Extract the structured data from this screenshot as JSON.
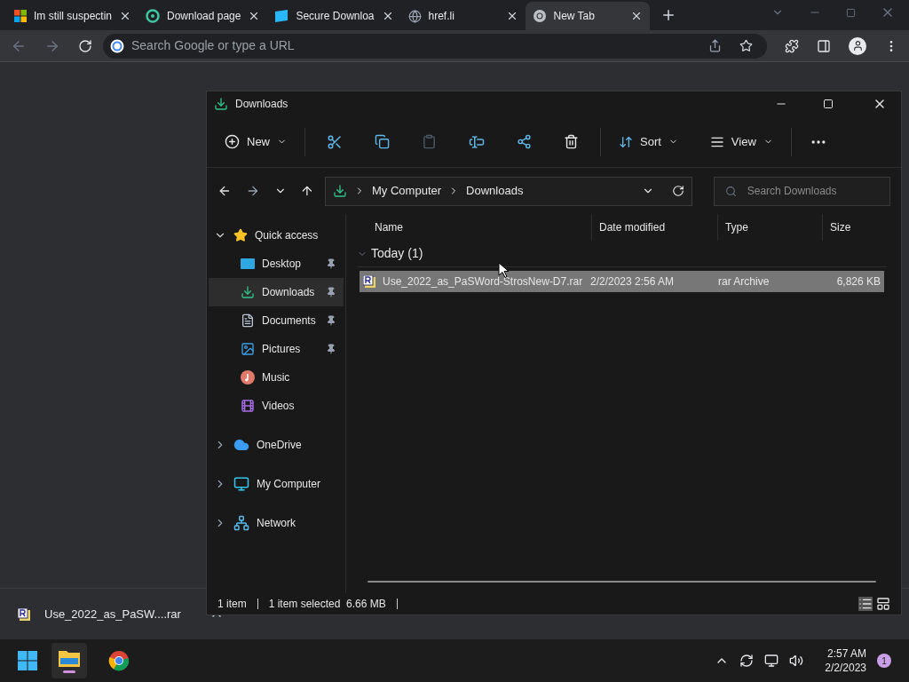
{
  "browser": {
    "tabs": [
      {
        "title": "Im still suspectin",
        "kind": "windows",
        "selected": false
      },
      {
        "title": "Download page",
        "kind": "ring",
        "selected": false
      },
      {
        "title": "Secure Downloa",
        "kind": "box",
        "selected": false
      },
      {
        "title": "href.li",
        "kind": "globe",
        "selected": false
      },
      {
        "title": "New Tab",
        "kind": "chrome",
        "selected": true
      }
    ],
    "omnibox": {
      "placeholder": "Search Google or type a URL"
    }
  },
  "explorer": {
    "title": "Downloads",
    "toolbar": {
      "new": "New",
      "sort": "Sort",
      "view": "View"
    },
    "address": {
      "crumbs": [
        "My Computer",
        "Downloads"
      ]
    },
    "search": {
      "placeholder": "Search Downloads"
    },
    "nav": [
      {
        "label": "Quick access",
        "kind": "star",
        "expanded": true,
        "children": [
          {
            "label": "Desktop",
            "kind": "desktop",
            "pinned": true,
            "selected": false
          },
          {
            "label": "Downloads",
            "kind": "download",
            "pinned": true,
            "selected": true
          },
          {
            "label": "Documents",
            "kind": "document",
            "pinned": true,
            "selected": false
          },
          {
            "label": "Pictures",
            "kind": "pictures",
            "pinned": true,
            "selected": false
          },
          {
            "label": "Music",
            "kind": "music",
            "pinned": false,
            "selected": false
          },
          {
            "label": "Videos",
            "kind": "videos",
            "pinned": false,
            "selected": false
          }
        ]
      },
      {
        "label": "OneDrive",
        "kind": "cloud",
        "expanded": false
      },
      {
        "label": "My Computer",
        "kind": "monitor",
        "expanded": false
      },
      {
        "label": "Network",
        "kind": "network",
        "expanded": false
      }
    ],
    "columns": [
      "Name",
      "Date modified",
      "Type",
      "Size"
    ],
    "group": {
      "label": "Today (1)",
      "expanded": true
    },
    "rows": [
      {
        "name": "Use_2022_as_PaSWord-StrosNew-D7.rar",
        "date": "2/2/2023 2:56 AM",
        "type": "rar Archive",
        "size": "6,826 KB",
        "selected": true
      }
    ],
    "status": {
      "count": "1 item",
      "selection": "1 item selected  6.66 MB"
    }
  },
  "download_shelf": {
    "file": "Use_2022_as_PaSW....rar"
  },
  "taskbar": {
    "time": "2:57 AM",
    "date": "2/2/2023",
    "notifications": "1"
  }
}
